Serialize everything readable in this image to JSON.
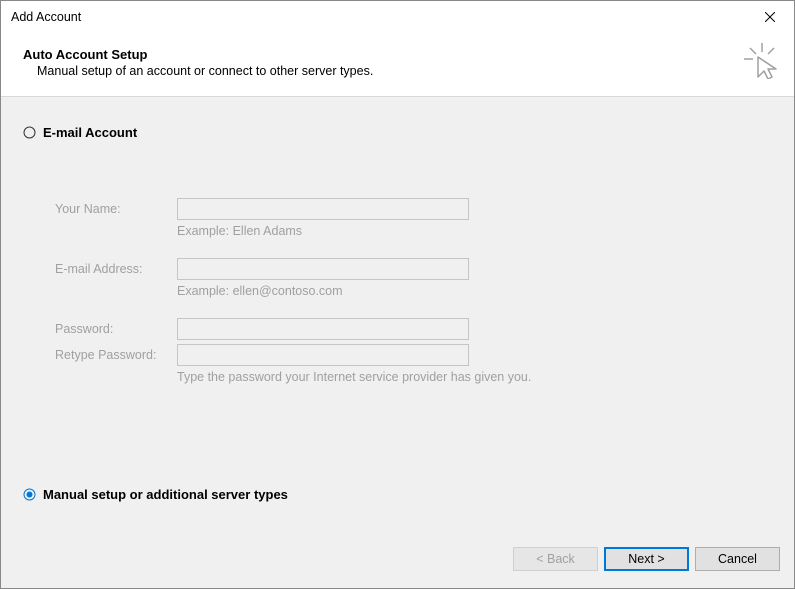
{
  "titlebar": {
    "title": "Add Account"
  },
  "header": {
    "title": "Auto Account Setup",
    "subtitle": "Manual setup of an account or connect to other server types."
  },
  "radios": {
    "email": {
      "label": "E-mail Account",
      "selected": false
    },
    "manual": {
      "label": "Manual setup or additional server types",
      "selected": true
    }
  },
  "form": {
    "name": {
      "label": "Your Name:",
      "value": "",
      "hint": "Example: Ellen Adams"
    },
    "email": {
      "label": "E-mail Address:",
      "value": "",
      "hint": "Example: ellen@contoso.com"
    },
    "password": {
      "label": "Password:",
      "value": ""
    },
    "retype": {
      "label": "Retype Password:",
      "value": "",
      "hint": "Type the password your Internet service provider has given you."
    }
  },
  "footer": {
    "back": "< Back",
    "next": "Next >",
    "cancel": "Cancel"
  }
}
